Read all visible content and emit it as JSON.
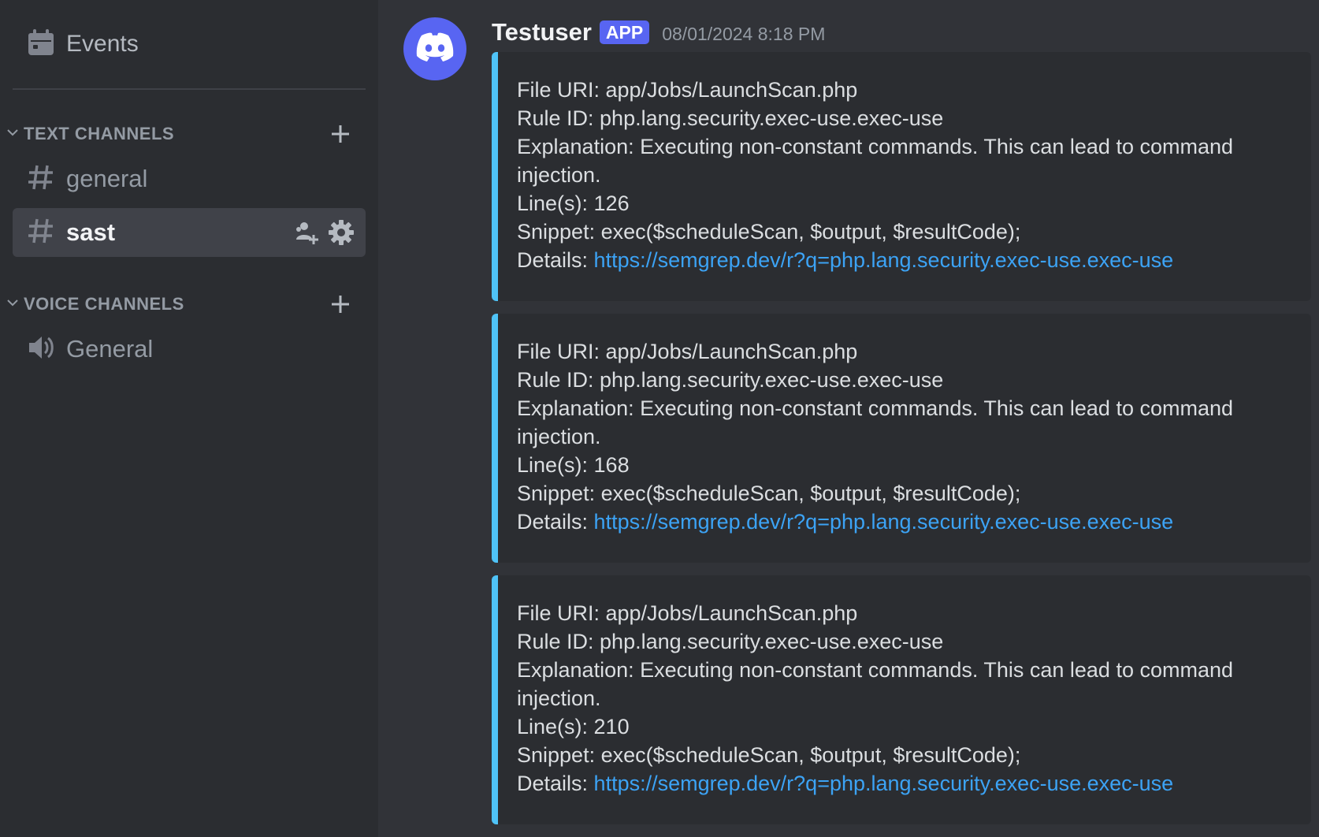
{
  "sidebar": {
    "events_label": "Events",
    "text_category": "TEXT CHANNELS",
    "voice_category": "VOICE CHANNELS",
    "text_channels": [
      {
        "label": "general"
      },
      {
        "label": "sast"
      }
    ],
    "voice_channels": [
      {
        "label": "General"
      }
    ]
  },
  "message": {
    "username": "Testuser",
    "badge": "APP",
    "timestamp": "08/01/2024 8:18 PM",
    "embed_color": "#4fc3f7",
    "embeds": [
      {
        "file_uri": "File URI: app/Jobs/LaunchScan.php",
        "rule_id": "Rule ID: php.lang.security.exec-use.exec-use",
        "explanation": "Explanation: Executing non-constant commands. This can lead to command injection.",
        "lines": "Line(s): 126",
        "snippet": "Snippet: exec($scheduleScan, $output, $resultCode);",
        "details_label": "Details: ",
        "details_url": "https://semgrep.dev/r?q=php.lang.security.exec-use.exec-use"
      },
      {
        "file_uri": "File URI: app/Jobs/LaunchScan.php",
        "rule_id": "Rule ID: php.lang.security.exec-use.exec-use",
        "explanation": "Explanation: Executing non-constant commands. This can lead to command injection.",
        "lines": "Line(s): 168",
        "snippet": "Snippet: exec($scheduleScan, $output, $resultCode);",
        "details_label": "Details: ",
        "details_url": "https://semgrep.dev/r?q=php.lang.security.exec-use.exec-use"
      },
      {
        "file_uri": "File URI: app/Jobs/LaunchScan.php",
        "rule_id": "Rule ID: php.lang.security.exec-use.exec-use",
        "explanation": "Explanation: Executing non-constant commands. This can lead to command injection.",
        "lines": "Line(s): 210",
        "snippet": "Snippet: exec($scheduleScan, $output, $resultCode);",
        "details_label": "Details: ",
        "details_url": "https://semgrep.dev/r?q=php.lang.security.exec-use.exec-use"
      }
    ]
  }
}
